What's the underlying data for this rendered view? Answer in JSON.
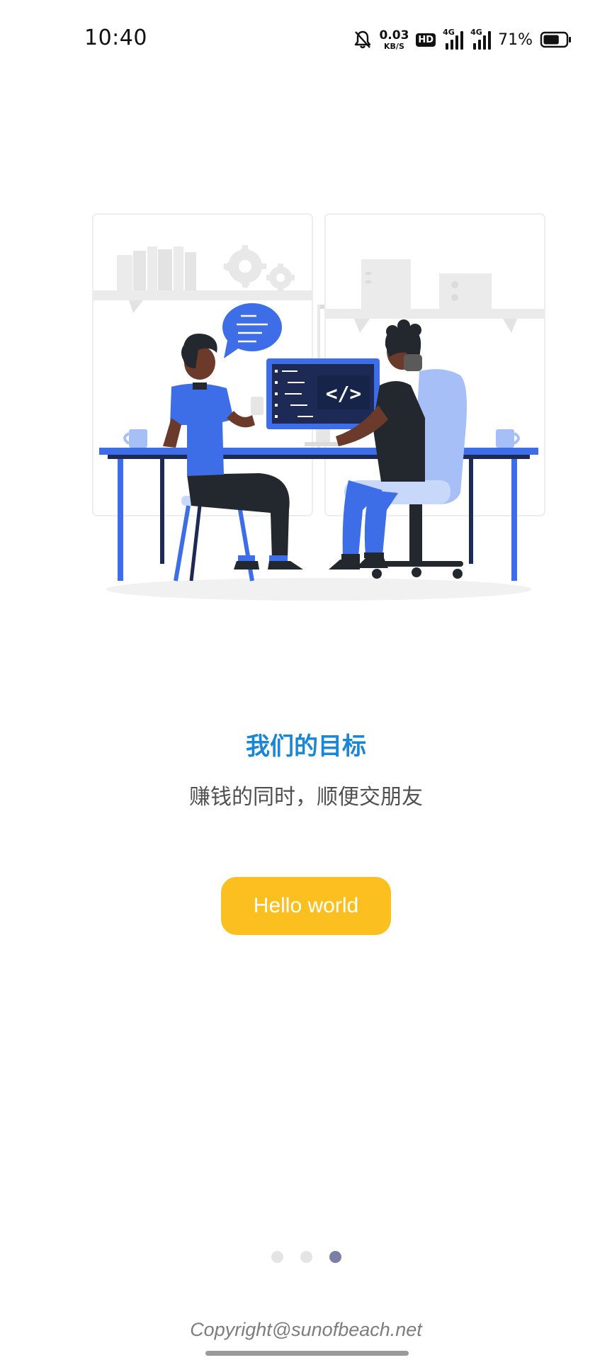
{
  "status_bar": {
    "time": "10:40",
    "net_speed_value": "0.03",
    "net_speed_unit": "KB/S",
    "hd_label": "HD",
    "signal1_label": "4G",
    "signal2_label": "4G",
    "battery_percent": "71%",
    "battery_level": 0.71,
    "icons": [
      "bell-muted-icon",
      "hd-icon",
      "signal-icon",
      "signal-icon",
      "battery-icon"
    ]
  },
  "intro": {
    "title": "我们的目标",
    "subtitle": "赚钱的同时，顺便交朋友",
    "illustration": "two-developers-at-desk-illustration",
    "code_symbol": "</>"
  },
  "button": {
    "label": "Hello world"
  },
  "pager": {
    "count": 3,
    "active_index": 2
  },
  "footer": {
    "copyright": "Copyright@sunofbeach.net"
  },
  "colors": {
    "title": "#1a86d6",
    "subtitle": "#505050",
    "button": "#fbbf1f",
    "illustration_blue": "#3d6ee8",
    "illustration_light_blue": "#a6c0f7",
    "illustration_dark": "#23272e",
    "dot_active": "#7b7fa6",
    "dot_inactive": "#e4e4e4"
  }
}
